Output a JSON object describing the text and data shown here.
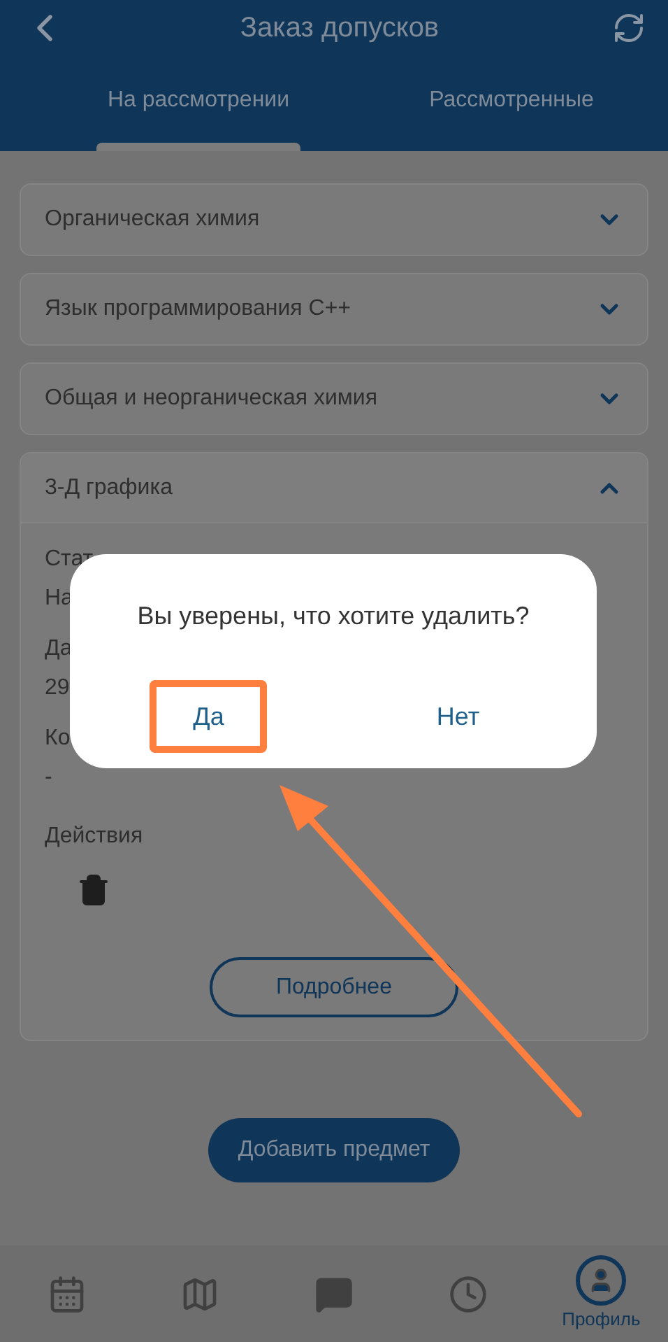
{
  "header": {
    "title": "Заказ допусков"
  },
  "tabs": [
    {
      "label": "На рассмотрении",
      "selected": true
    },
    {
      "label": "Рассмотренные",
      "selected": false
    }
  ],
  "subjects": [
    {
      "title": "Органическая химия",
      "expanded": false
    },
    {
      "title": "Язык программирования С++",
      "expanded": false
    },
    {
      "title": "Общая и неорганическая химия",
      "expanded": false
    },
    {
      "title": "3-Д графика",
      "expanded": true,
      "fields": [
        {
          "label": "Стат",
          "value": "На"
        },
        {
          "label": "Да",
          "value": "29"
        },
        {
          "label": "Ко",
          "value": "-"
        }
      ],
      "actions_label": "Действия",
      "details_button": "Подробнее"
    }
  ],
  "add_button": "Добавить предмет",
  "bottom_nav": [
    {
      "kind": "calendar",
      "selected": false
    },
    {
      "kind": "map",
      "selected": false
    },
    {
      "kind": "chat",
      "selected": false
    },
    {
      "kind": "history",
      "selected": false
    },
    {
      "kind": "profile",
      "selected": true,
      "label": "Профиль"
    }
  ],
  "dialog": {
    "message": "Вы уверены, что хотите удалить?",
    "buttons": [
      {
        "label": "Да",
        "highlighted": true
      },
      {
        "label": "Нет",
        "highlighted": false
      }
    ]
  }
}
